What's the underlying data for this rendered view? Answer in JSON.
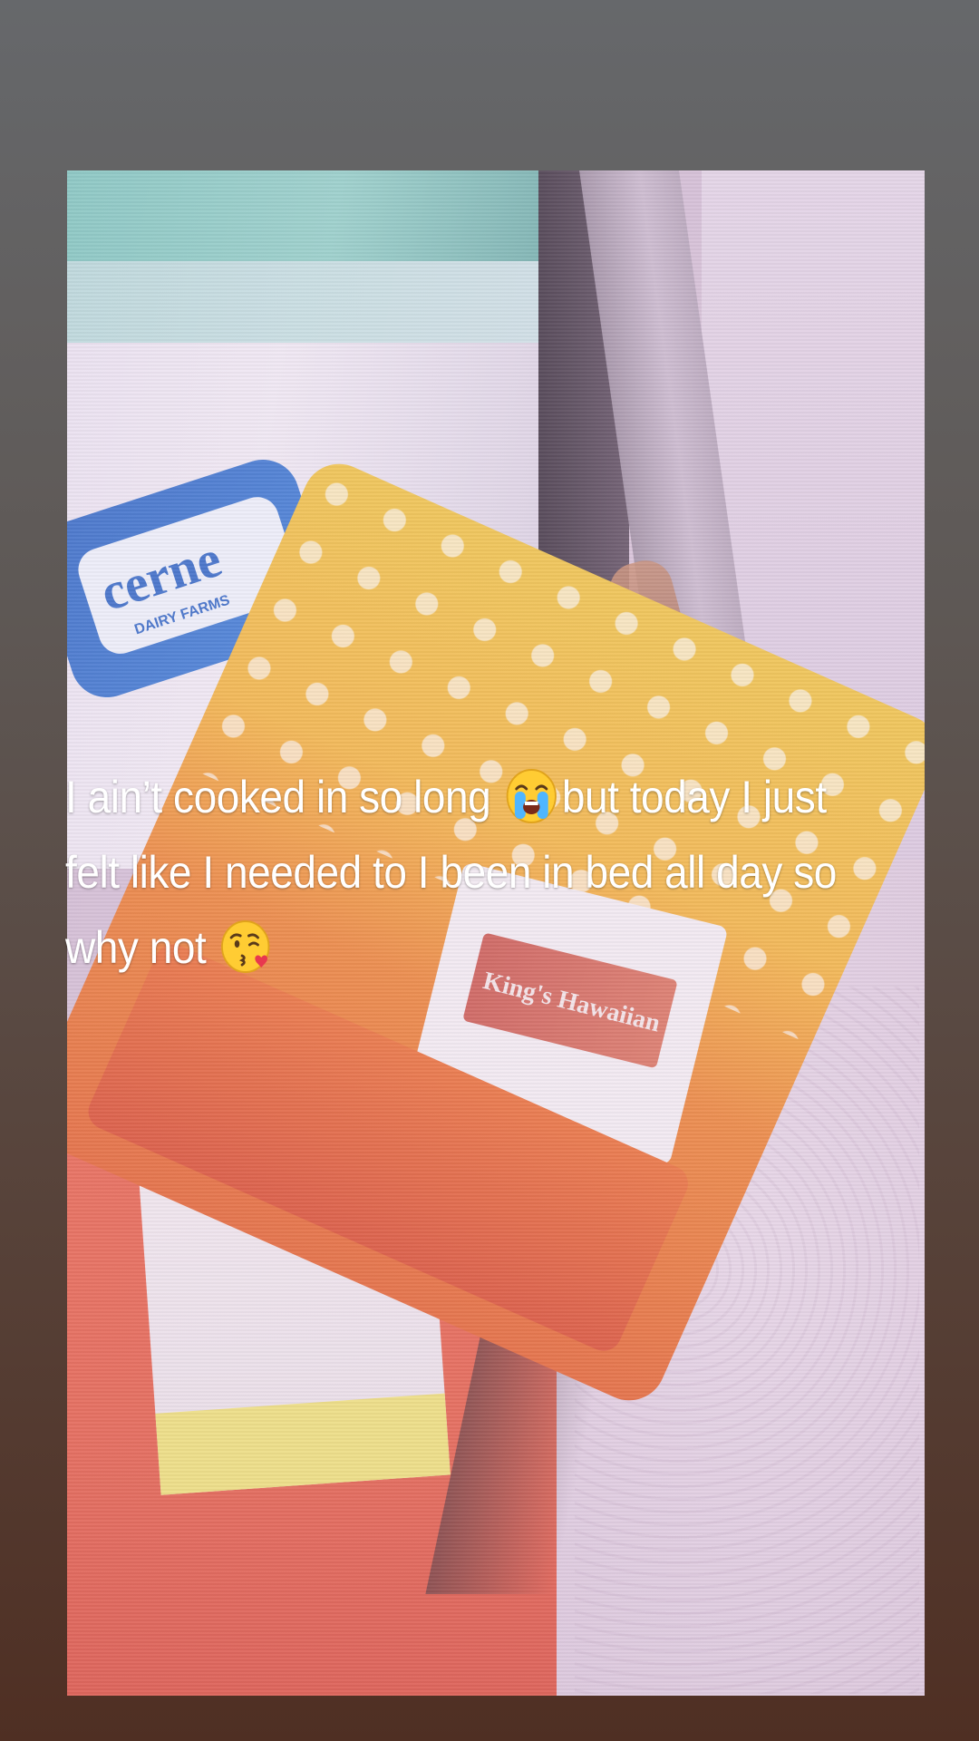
{
  "story": {
    "caption": {
      "part1": "I ain’t cooked in so long ",
      "part2": "but today I just felt like I needed to I been in bed all day so why not ",
      "emoji_1": "loudly-crying-face-icon",
      "emoji_2": "face-blowing-kiss-icon"
    },
    "photo": {
      "jug_brand_text": "cerne",
      "jug_brand_sub": "DAIRY FARMS",
      "bag_brand_text": "King's Hawaiian"
    }
  },
  "colors": {
    "frame_background_top": "#66686b",
    "frame_background_bottom": "#4f2f23",
    "caption_text": "#ffffff",
    "bag_yellow": "#f0c33d",
    "bag_orange": "#e4602b",
    "jug_label_blue": "#2a63c3"
  }
}
